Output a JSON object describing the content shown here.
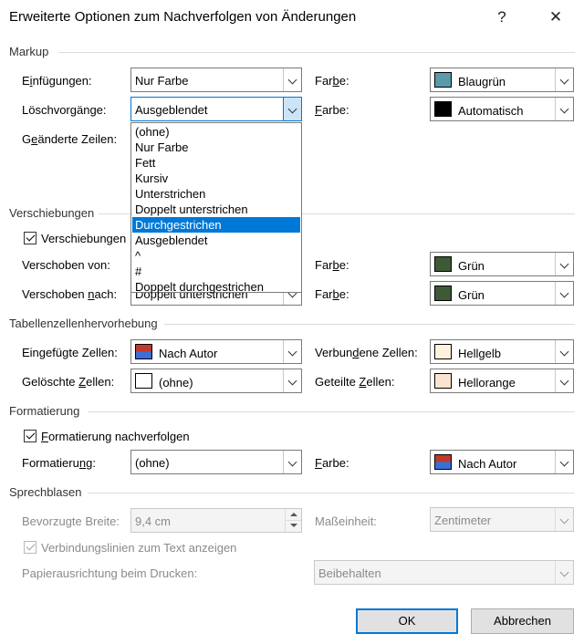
{
  "window": {
    "title": "Erweiterte Optionen zum Nachverfolgen von Änderungen",
    "help": "?",
    "close": "✕"
  },
  "markup": {
    "section": "Markup",
    "insertions_label_pre": "E",
    "insertions_label_u": "i",
    "insertions_label_post": "nfügungen:",
    "insertions_value": "Nur Farbe",
    "deletions_label": "Löschvorgänge:",
    "deletions_value": "Ausgeblendet",
    "changed_lines_label_pre": "G",
    "changed_lines_label_u": "e",
    "changed_lines_label_post": "änderte Zeilen:",
    "color1_label_pre": "Far",
    "color1_label_u": "b",
    "color1_label_post": "e:",
    "color1_value": "Blaugrün",
    "color1_hex": "#5b9aa9",
    "color2_label_pre": "",
    "color2_label_u": "F",
    "color2_label_post": "arbe:",
    "color2_value": "Automatisch",
    "color2_hex": "#000000"
  },
  "dropdown": {
    "items": [
      "(ohne)",
      "Nur Farbe",
      "Fett",
      "Kursiv",
      "Unterstrichen",
      "Doppelt unterstrichen",
      "Durchgestrichen",
      "Ausgeblendet",
      "^",
      "#",
      "Doppelt durchgestrichen"
    ],
    "selected_index": 6
  },
  "moves": {
    "section": "Verschiebungen",
    "track_moves_label": "Verschiebungen",
    "track_moves_checked": true,
    "moved_from_label": "Verschoben von:",
    "moved_to_label_pre": "Verschoben ",
    "moved_to_label_u": "n",
    "moved_to_label_post": "ach:",
    "moved_to_value": "Doppelt unterstrichen",
    "color3_label_pre": "Far",
    "color3_label_u": "b",
    "color3_label_post": "e:",
    "color3_value": "Grün",
    "color3_hex": "#3c5a36",
    "color4_label_pre": "Far",
    "color4_label_u": "b",
    "color4_label_post": "e:",
    "color4_value": "Grün",
    "color4_hex": "#3c5a36"
  },
  "table": {
    "section": "Tabellenzellenhervorhebung",
    "inserted_label_pre": "Eingefü",
    "inserted_label_u": "g",
    "inserted_label_post": "te Zellen:",
    "inserted_value": "Nach Autor",
    "deleted_label_pre": "Gelöschte ",
    "deleted_label_u": "Z",
    "deleted_label_post": "ellen:",
    "deleted_value": "(ohne)",
    "merged_label_pre": "Verbun",
    "merged_label_u": "d",
    "merged_label_post": "ene Zellen:",
    "merged_value": "Hellgelb",
    "merged_hex": "#fdf3dc",
    "split_label_pre": "Geteilte ",
    "split_label_u": "Z",
    "split_label_post": "ellen:",
    "split_value": "Hellorange",
    "split_hex": "#fbe3cf"
  },
  "formatting": {
    "section": "Formatierung",
    "track_label_pre": "",
    "track_label_u": "F",
    "track_label_post": "ormatierung nachverfolgen",
    "track_checked": true,
    "format_label_pre": "Formatieru",
    "format_label_u": "n",
    "format_label_post": "g:",
    "format_value": "(ohne)",
    "color_label_pre": "",
    "color_label_u": "F",
    "color_label_post": "arbe:",
    "color_value": "Nach Autor"
  },
  "balloons": {
    "section": "Sprechblasen",
    "width_label": "Bevorzugte Breite:",
    "width_value": "9,4 cm",
    "unit_label": "Maßeinheit:",
    "unit_value": "Zentimeter",
    "lines_label": "Verbindungslinien zum Text anzeigen",
    "lines_checked": true,
    "orientation_label": "Papierausrichtung beim Drucken:",
    "orientation_value": "Beibehalten"
  },
  "buttons": {
    "ok": "OK",
    "cancel": "Abbrechen"
  }
}
